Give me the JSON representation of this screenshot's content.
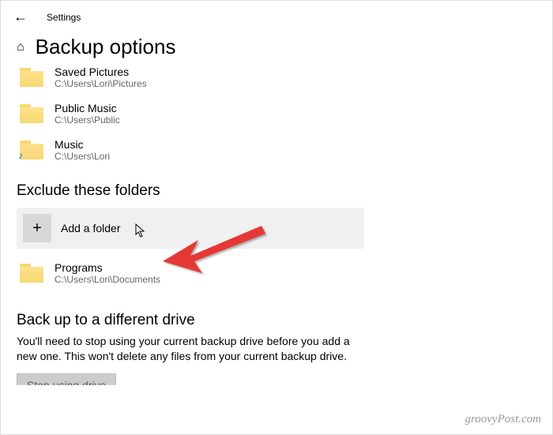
{
  "topbar": {
    "settings_label": "Settings"
  },
  "header": {
    "title": "Backup options"
  },
  "folders": [
    {
      "name": "Saved Pictures",
      "path": "C:\\Users\\Lori\\Pictures",
      "music": false
    },
    {
      "name": "Public Music",
      "path": "C:\\Users\\Public",
      "music": false
    },
    {
      "name": "Music",
      "path": "C:\\Users\\Lori",
      "music": true
    }
  ],
  "exclude": {
    "title": "Exclude these folders",
    "add_label": "Add a folder",
    "items": [
      {
        "name": "Programs",
        "path": "C:\\Users\\Lori\\Documents"
      }
    ]
  },
  "switch_drive": {
    "title": "Back up to a different drive",
    "desc": "You'll need to stop using your current backup drive before you add a new one. This won't delete any files from your current backup drive.",
    "button": "Stop using drive"
  },
  "watermark": "groovyPost.com"
}
